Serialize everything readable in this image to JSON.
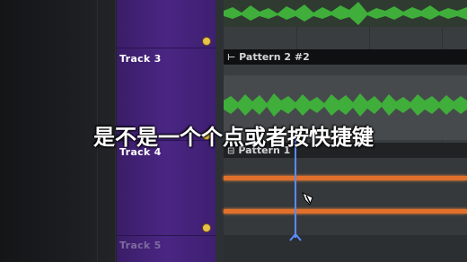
{
  "tracks": [
    {
      "label": "Track 3"
    },
    {
      "label": "Track 4"
    },
    {
      "label": "Track 5"
    }
  ],
  "patterns": [
    {
      "name": "Pattern 2 #2",
      "icon": "⊢"
    },
    {
      "name": "Pattern 1",
      "icon": "⊟"
    }
  ],
  "subtitle": "是不是一个个点或者按快捷键",
  "colors": {
    "track_panel": "#4a2683",
    "audio_wave": "#3fae3a",
    "note_bar": "#e0702c",
    "playhead": "#5a8cff",
    "mute_dot": "#e8c24a"
  }
}
